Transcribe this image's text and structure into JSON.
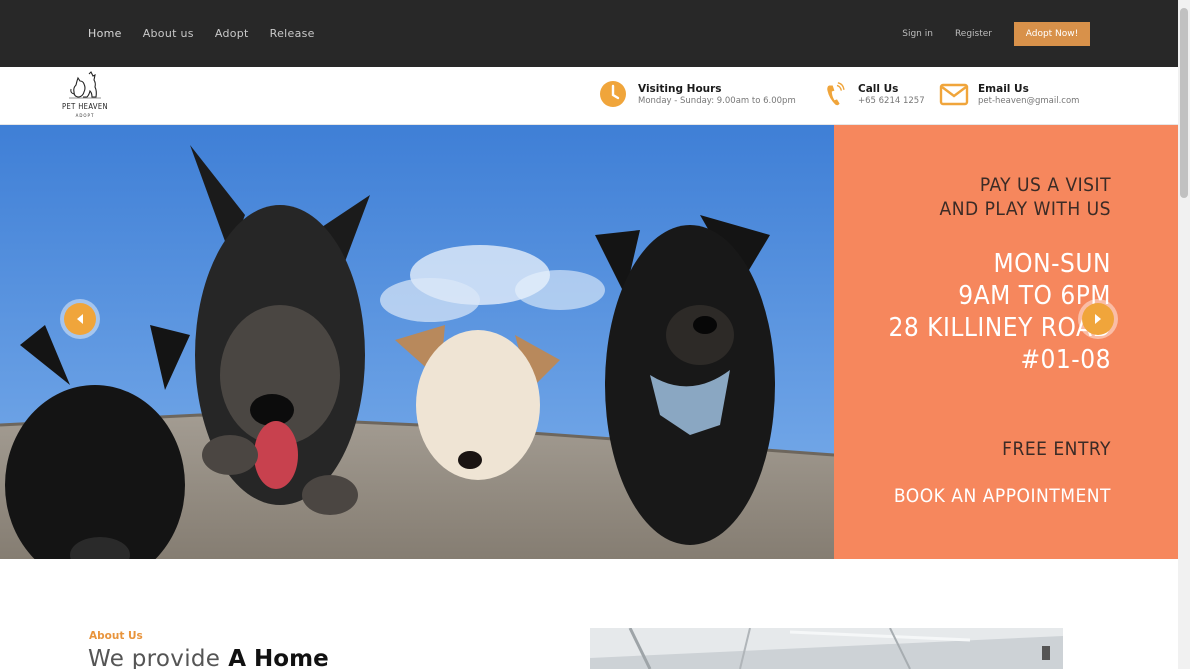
{
  "nav": {
    "links": [
      "Home",
      "About us",
      "Adopt",
      "Release"
    ],
    "signin": "Sign in",
    "register": "Register",
    "cta": "Adopt Now!"
  },
  "brand": {
    "name": "PET HEAVEN",
    "tagline": "ADOPT"
  },
  "contact": {
    "hours_title": "Visiting Hours",
    "hours_text": "Monday - Sunday: 9.00am to 6.00pm",
    "call_title": "Call Us",
    "call_text": "+65 6214 1257",
    "email_title": "Email Us",
    "email_text": "pet-heaven@gmail.com"
  },
  "hero": {
    "visit_line1": "PAY US A VISIT",
    "visit_line2": "AND PLAY WITH US",
    "hours_line1": "MON-SUN",
    "hours_line2": "9AM TO 6PM",
    "address_line1": "28 KILLINEY ROAD",
    "address_line2": "#01-08",
    "free_entry": "FREE ENTRY",
    "book": "BOOK AN APPOINTMENT"
  },
  "about": {
    "label": "About Us",
    "heading_light": "We provide",
    "heading_bold": "A Home"
  },
  "colors": {
    "topbar": "#282828",
    "accent_button": "#d8914a",
    "panel": "#f6875d",
    "icon_orange": "#f0a53b"
  },
  "icons": [
    "clock-icon",
    "phone-icon",
    "mail-icon",
    "arrow-left-icon",
    "arrow-right-icon"
  ]
}
